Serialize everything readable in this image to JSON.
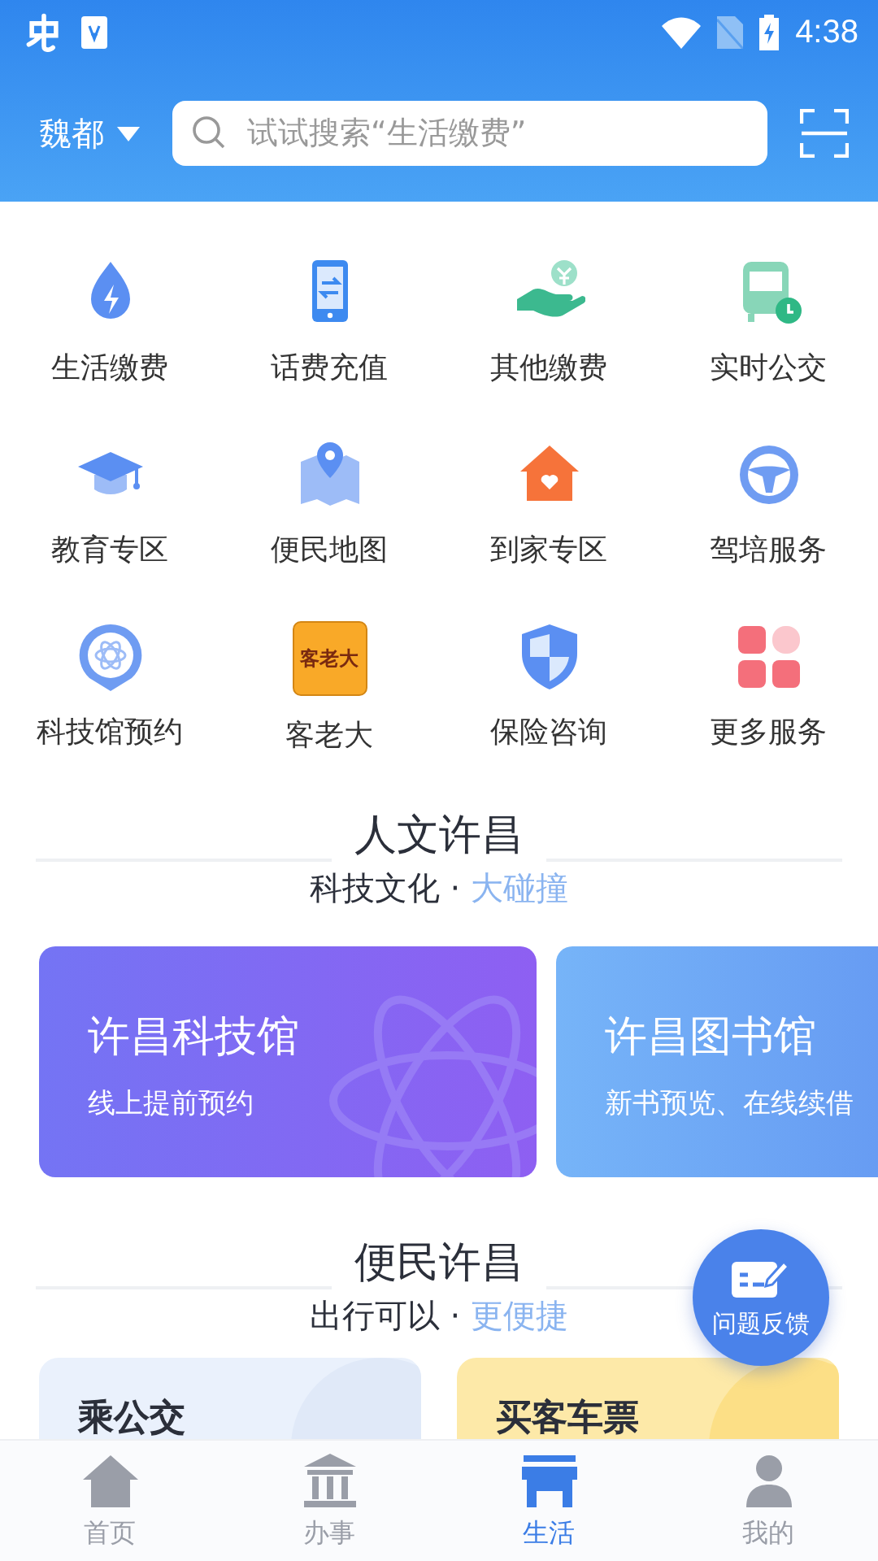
{
  "status_bar": {
    "time": "4:38"
  },
  "header": {
    "city": "魏都",
    "search": {
      "placeholder": "试试搜索“生活缴费”"
    }
  },
  "services": [
    {
      "label": "生活缴费"
    },
    {
      "label": "话费充值"
    },
    {
      "label": "其他缴费"
    },
    {
      "label": "实时公交"
    },
    {
      "label": "教育专区"
    },
    {
      "label": "便民地图"
    },
    {
      "label": "到家专区"
    },
    {
      "label": "驾培服务"
    },
    {
      "label": "科技馆预约"
    },
    {
      "label": "客老大",
      "logo_text": "客老大"
    },
    {
      "label": "保险咨询"
    },
    {
      "label": "更多服务"
    }
  ],
  "sections": [
    {
      "title": "人文许昌",
      "subtitle": {
        "lead": "科技文化 · ",
        "highlight": "大碰撞"
      },
      "cards": [
        {
          "title": "许昌科技馆",
          "text": "线上提前预约"
        },
        {
          "title": "许昌图书馆",
          "text": "新书预览、在线续借"
        }
      ]
    },
    {
      "title": "便民许昌",
      "subtitle": {
        "lead": "出行可以 · ",
        "highlight": "更便捷"
      },
      "cards": [
        {
          "title": "乘公交"
        },
        {
          "title": "买客车票"
        }
      ]
    }
  ],
  "feedback_button": {
    "label": "问题反馈"
  },
  "bottom_nav": [
    {
      "label": "首页",
      "selected": false
    },
    {
      "label": "办事",
      "selected": false
    },
    {
      "label": "生活",
      "selected": true
    },
    {
      "label": "我的",
      "selected": false
    }
  ]
}
